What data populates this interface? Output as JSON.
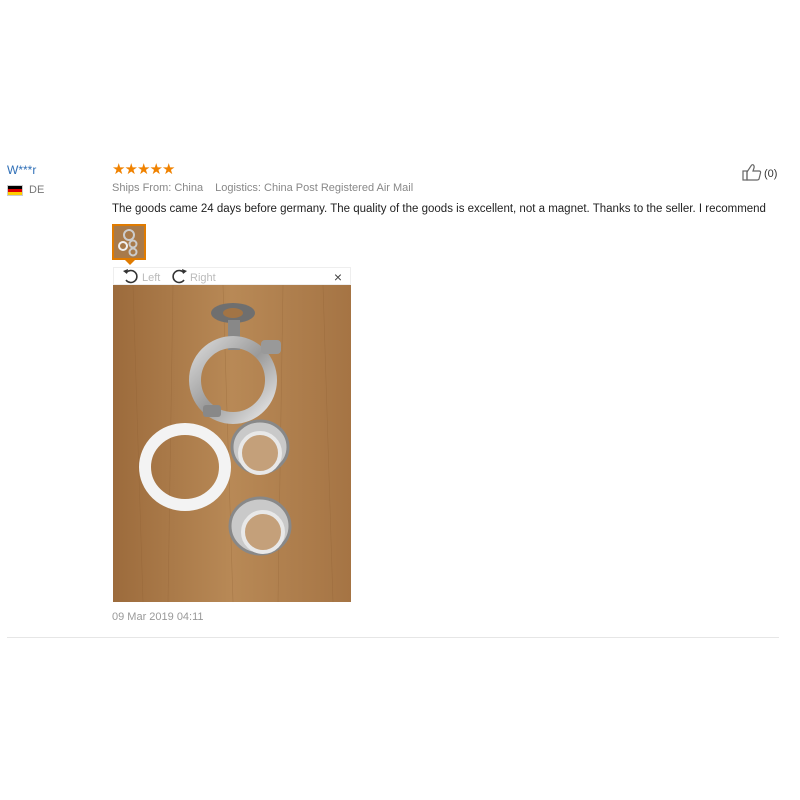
{
  "review": {
    "user_name": "W***r",
    "country": "DE",
    "rating_stars": 5,
    "ships_from": "Ships From: China",
    "logistics": "Logistics: China Post Registered Air Mail",
    "text": "The goods came 24 days before germany. The quality of the goods is excellent, not a magnet. Thanks to the seller. I recommend",
    "helpful_count": "(0)",
    "date": "09 Mar 2019 04:11",
    "viewer": {
      "rotate_left_label": "Left",
      "rotate_right_label": "Right",
      "close_label": "×"
    }
  },
  "icons": {
    "star": "star-icon",
    "thumbs_up": "thumbs-up-icon",
    "rotate_left": "rotate-left-icon",
    "rotate_right": "rotate-right-icon",
    "close": "close-icon",
    "flag": "germany-flag-icon"
  },
  "colors": {
    "star": "#f08200",
    "username": "#2f6fb7",
    "thumbnail_border": "#e07b00",
    "flag_black": "#000000",
    "flag_red": "#dd0000",
    "flag_gold": "#ffce00"
  }
}
